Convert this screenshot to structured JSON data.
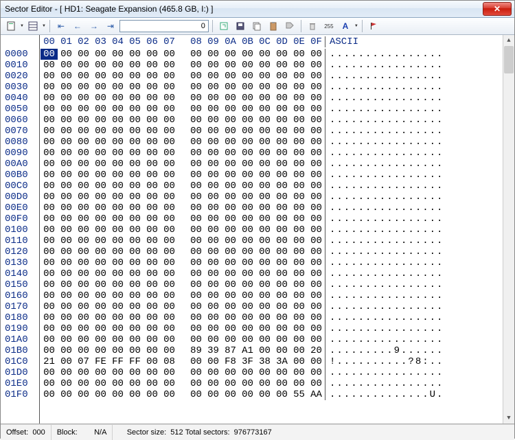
{
  "window": {
    "title": "Sector Editor - [ HD1: Seagate Expansion (465.8 GB, I:) ]"
  },
  "toolbar": {
    "sector_input": "0"
  },
  "hex": {
    "header_offsets": [
      "00",
      "01",
      "02",
      "03",
      "04",
      "05",
      "06",
      "07",
      "08",
      "09",
      "0A",
      "0B",
      "0C",
      "0D",
      "0E",
      "0F"
    ],
    "ascii_header": "ASCII",
    "rows": [
      {
        "offset": "0000",
        "bytes": [
          "00",
          "00",
          "00",
          "00",
          "00",
          "00",
          "00",
          "00",
          "00",
          "00",
          "00",
          "00",
          "00",
          "00",
          "00",
          "00"
        ],
        "ascii": "................"
      },
      {
        "offset": "0010",
        "bytes": [
          "00",
          "00",
          "00",
          "00",
          "00",
          "00",
          "00",
          "00",
          "00",
          "00",
          "00",
          "00",
          "00",
          "00",
          "00",
          "00"
        ],
        "ascii": "................"
      },
      {
        "offset": "0020",
        "bytes": [
          "00",
          "00",
          "00",
          "00",
          "00",
          "00",
          "00",
          "00",
          "00",
          "00",
          "00",
          "00",
          "00",
          "00",
          "00",
          "00"
        ],
        "ascii": "................"
      },
      {
        "offset": "0030",
        "bytes": [
          "00",
          "00",
          "00",
          "00",
          "00",
          "00",
          "00",
          "00",
          "00",
          "00",
          "00",
          "00",
          "00",
          "00",
          "00",
          "00"
        ],
        "ascii": "................"
      },
      {
        "offset": "0040",
        "bytes": [
          "00",
          "00",
          "00",
          "00",
          "00",
          "00",
          "00",
          "00",
          "00",
          "00",
          "00",
          "00",
          "00",
          "00",
          "00",
          "00"
        ],
        "ascii": "................"
      },
      {
        "offset": "0050",
        "bytes": [
          "00",
          "00",
          "00",
          "00",
          "00",
          "00",
          "00",
          "00",
          "00",
          "00",
          "00",
          "00",
          "00",
          "00",
          "00",
          "00"
        ],
        "ascii": "................"
      },
      {
        "offset": "0060",
        "bytes": [
          "00",
          "00",
          "00",
          "00",
          "00",
          "00",
          "00",
          "00",
          "00",
          "00",
          "00",
          "00",
          "00",
          "00",
          "00",
          "00"
        ],
        "ascii": "................"
      },
      {
        "offset": "0070",
        "bytes": [
          "00",
          "00",
          "00",
          "00",
          "00",
          "00",
          "00",
          "00",
          "00",
          "00",
          "00",
          "00",
          "00",
          "00",
          "00",
          "00"
        ],
        "ascii": "................"
      },
      {
        "offset": "0080",
        "bytes": [
          "00",
          "00",
          "00",
          "00",
          "00",
          "00",
          "00",
          "00",
          "00",
          "00",
          "00",
          "00",
          "00",
          "00",
          "00",
          "00"
        ],
        "ascii": "................"
      },
      {
        "offset": "0090",
        "bytes": [
          "00",
          "00",
          "00",
          "00",
          "00",
          "00",
          "00",
          "00",
          "00",
          "00",
          "00",
          "00",
          "00",
          "00",
          "00",
          "00"
        ],
        "ascii": "................"
      },
      {
        "offset": "00A0",
        "bytes": [
          "00",
          "00",
          "00",
          "00",
          "00",
          "00",
          "00",
          "00",
          "00",
          "00",
          "00",
          "00",
          "00",
          "00",
          "00",
          "00"
        ],
        "ascii": "................"
      },
      {
        "offset": "00B0",
        "bytes": [
          "00",
          "00",
          "00",
          "00",
          "00",
          "00",
          "00",
          "00",
          "00",
          "00",
          "00",
          "00",
          "00",
          "00",
          "00",
          "00"
        ],
        "ascii": "................"
      },
      {
        "offset": "00C0",
        "bytes": [
          "00",
          "00",
          "00",
          "00",
          "00",
          "00",
          "00",
          "00",
          "00",
          "00",
          "00",
          "00",
          "00",
          "00",
          "00",
          "00"
        ],
        "ascii": "................"
      },
      {
        "offset": "00D0",
        "bytes": [
          "00",
          "00",
          "00",
          "00",
          "00",
          "00",
          "00",
          "00",
          "00",
          "00",
          "00",
          "00",
          "00",
          "00",
          "00",
          "00"
        ],
        "ascii": "................"
      },
      {
        "offset": "00E0",
        "bytes": [
          "00",
          "00",
          "00",
          "00",
          "00",
          "00",
          "00",
          "00",
          "00",
          "00",
          "00",
          "00",
          "00",
          "00",
          "00",
          "00"
        ],
        "ascii": "................"
      },
      {
        "offset": "00F0",
        "bytes": [
          "00",
          "00",
          "00",
          "00",
          "00",
          "00",
          "00",
          "00",
          "00",
          "00",
          "00",
          "00",
          "00",
          "00",
          "00",
          "00"
        ],
        "ascii": "................"
      },
      {
        "offset": "0100",
        "bytes": [
          "00",
          "00",
          "00",
          "00",
          "00",
          "00",
          "00",
          "00",
          "00",
          "00",
          "00",
          "00",
          "00",
          "00",
          "00",
          "00"
        ],
        "ascii": "................"
      },
      {
        "offset": "0110",
        "bytes": [
          "00",
          "00",
          "00",
          "00",
          "00",
          "00",
          "00",
          "00",
          "00",
          "00",
          "00",
          "00",
          "00",
          "00",
          "00",
          "00"
        ],
        "ascii": "................"
      },
      {
        "offset": "0120",
        "bytes": [
          "00",
          "00",
          "00",
          "00",
          "00",
          "00",
          "00",
          "00",
          "00",
          "00",
          "00",
          "00",
          "00",
          "00",
          "00",
          "00"
        ],
        "ascii": "................"
      },
      {
        "offset": "0130",
        "bytes": [
          "00",
          "00",
          "00",
          "00",
          "00",
          "00",
          "00",
          "00",
          "00",
          "00",
          "00",
          "00",
          "00",
          "00",
          "00",
          "00"
        ],
        "ascii": "................"
      },
      {
        "offset": "0140",
        "bytes": [
          "00",
          "00",
          "00",
          "00",
          "00",
          "00",
          "00",
          "00",
          "00",
          "00",
          "00",
          "00",
          "00",
          "00",
          "00",
          "00"
        ],
        "ascii": "................"
      },
      {
        "offset": "0150",
        "bytes": [
          "00",
          "00",
          "00",
          "00",
          "00",
          "00",
          "00",
          "00",
          "00",
          "00",
          "00",
          "00",
          "00",
          "00",
          "00",
          "00"
        ],
        "ascii": "................"
      },
      {
        "offset": "0160",
        "bytes": [
          "00",
          "00",
          "00",
          "00",
          "00",
          "00",
          "00",
          "00",
          "00",
          "00",
          "00",
          "00",
          "00",
          "00",
          "00",
          "00"
        ],
        "ascii": "................"
      },
      {
        "offset": "0170",
        "bytes": [
          "00",
          "00",
          "00",
          "00",
          "00",
          "00",
          "00",
          "00",
          "00",
          "00",
          "00",
          "00",
          "00",
          "00",
          "00",
          "00"
        ],
        "ascii": "................"
      },
      {
        "offset": "0180",
        "bytes": [
          "00",
          "00",
          "00",
          "00",
          "00",
          "00",
          "00",
          "00",
          "00",
          "00",
          "00",
          "00",
          "00",
          "00",
          "00",
          "00"
        ],
        "ascii": "................"
      },
      {
        "offset": "0190",
        "bytes": [
          "00",
          "00",
          "00",
          "00",
          "00",
          "00",
          "00",
          "00",
          "00",
          "00",
          "00",
          "00",
          "00",
          "00",
          "00",
          "00"
        ],
        "ascii": "................"
      },
      {
        "offset": "01A0",
        "bytes": [
          "00",
          "00",
          "00",
          "00",
          "00",
          "00",
          "00",
          "00",
          "00",
          "00",
          "00",
          "00",
          "00",
          "00",
          "00",
          "00"
        ],
        "ascii": "................"
      },
      {
        "offset": "01B0",
        "bytes": [
          "00",
          "00",
          "00",
          "00",
          "00",
          "00",
          "00",
          "00",
          "89",
          "39",
          "87",
          "A1",
          "00",
          "00",
          "00",
          "20"
        ],
        "ascii": ".........9......"
      },
      {
        "offset": "01C0",
        "bytes": [
          "21",
          "00",
          "07",
          "FE",
          "FF",
          "FF",
          "00",
          "08",
          "00",
          "00",
          "F8",
          "3F",
          "38",
          "3A",
          "00",
          "00"
        ],
        "ascii": "!..........?8:.."
      },
      {
        "offset": "01D0",
        "bytes": [
          "00",
          "00",
          "00",
          "00",
          "00",
          "00",
          "00",
          "00",
          "00",
          "00",
          "00",
          "00",
          "00",
          "00",
          "00",
          "00"
        ],
        "ascii": "................"
      },
      {
        "offset": "01E0",
        "bytes": [
          "00",
          "00",
          "00",
          "00",
          "00",
          "00",
          "00",
          "00",
          "00",
          "00",
          "00",
          "00",
          "00",
          "00",
          "00",
          "00"
        ],
        "ascii": "................"
      },
      {
        "offset": "01F0",
        "bytes": [
          "00",
          "00",
          "00",
          "00",
          "00",
          "00",
          "00",
          "00",
          "00",
          "00",
          "00",
          "00",
          "00",
          "00",
          "55",
          "AA"
        ],
        "ascii": "..............U."
      }
    ],
    "cursor": {
      "row": 0,
      "col": 0
    }
  },
  "status": {
    "offset_label": "Offset:",
    "offset_value": "000",
    "block_label": "Block:",
    "block_value": "N/A",
    "sector_size_label": "Sector size:",
    "sector_size_value": "512",
    "total_sectors_label": "Total sectors:",
    "total_sectors_value": "976773167"
  }
}
